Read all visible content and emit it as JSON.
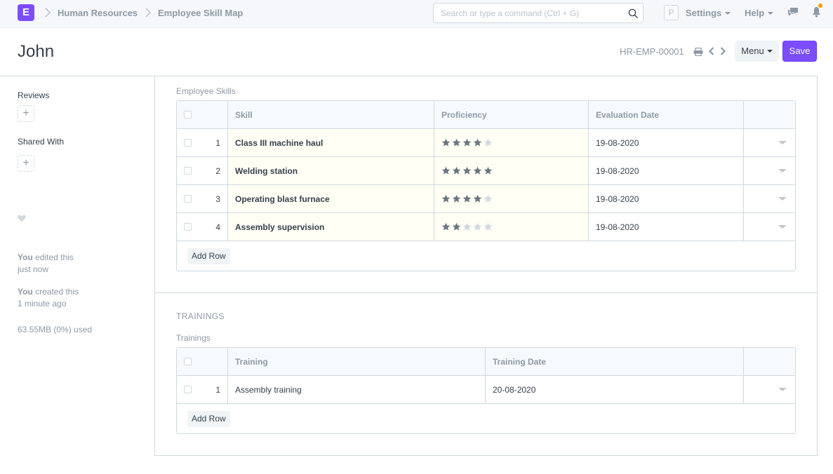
{
  "navbar": {
    "logo_letter": "E",
    "breadcrumbs": [
      "Human Resources",
      "Employee Skill Map"
    ],
    "search_placeholder": "Search or type a command (Ctrl + G)",
    "user_initial": "P",
    "settings_label": "Settings",
    "help_label": "Help",
    "icons": [
      "search-icon",
      "chat-icon",
      "bell-icon"
    ],
    "notification_dot_color": "#ff9800"
  },
  "header": {
    "title": "John",
    "doc_id": "HR-EMP-00001",
    "menu_label": "Menu",
    "save_label": "Save",
    "accent_color": "#7c4dff"
  },
  "sidebar": {
    "reviews_label": "Reviews",
    "shared_with_label": "Shared With",
    "add_symbol": "+",
    "activity": [
      {
        "actor": "You",
        "action": " edited this",
        "when": "just now"
      },
      {
        "actor": "You",
        "action": " created this",
        "when": "1 minute ago"
      }
    ],
    "storage": "63.55MB (0%) used"
  },
  "skills": {
    "label": "Employee Skills",
    "columns": [
      "Skill",
      "Proficiency",
      "Evaluation Date"
    ],
    "rows": [
      {
        "idx": "1",
        "skill": "Class III machine haul",
        "rating": 4,
        "max": 5,
        "date": "19-08-2020"
      },
      {
        "idx": "2",
        "skill": "Welding station",
        "rating": 5,
        "max": 5,
        "date": "19-08-2020"
      },
      {
        "idx": "3",
        "skill": "Operating blast furnace",
        "rating": 4,
        "max": 5,
        "date": "19-08-2020"
      },
      {
        "idx": "4",
        "skill": "Assembly supervision",
        "rating": 2,
        "max": 5,
        "date": "19-08-2020"
      }
    ],
    "add_row_label": "Add Row"
  },
  "trainings": {
    "section_title": "TRAININGS",
    "label": "Trainings",
    "columns": [
      "Training",
      "Training Date"
    ],
    "rows": [
      {
        "idx": "1",
        "training": "Assembly training",
        "date": "20-08-2020"
      }
    ],
    "add_row_label": "Add Row"
  }
}
